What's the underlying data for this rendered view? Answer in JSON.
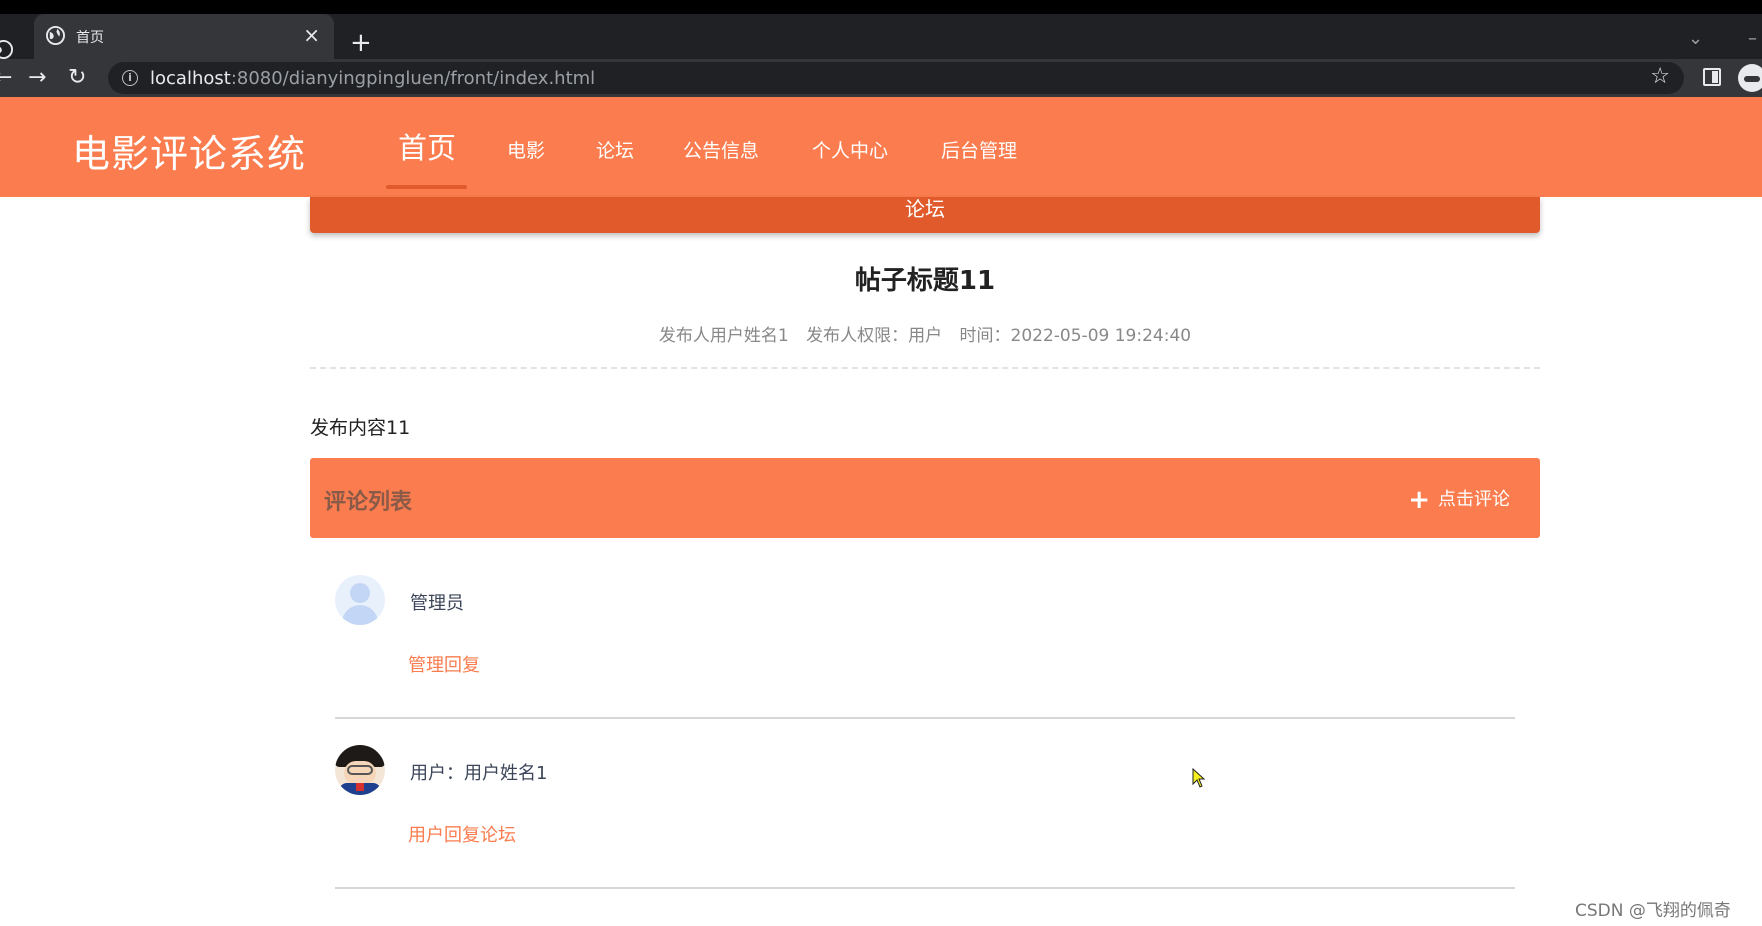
{
  "browser": {
    "tab_title": "首页",
    "url_host": "localhost",
    "url_rest": ":8080/dianyingpingluen/front/index.html",
    "icons": [
      "globe-icon",
      "close-icon",
      "plus-icon",
      "back-icon",
      "forward-icon",
      "reload-icon",
      "info-icon",
      "star-icon",
      "side-panel-icon",
      "profile-icon",
      "chevron-down-icon"
    ]
  },
  "site": {
    "brand": "电影评论系统",
    "accent_color": "#fb7c4e",
    "nav": [
      {
        "label": "首页",
        "active": true
      },
      {
        "label": "电影"
      },
      {
        "label": "论坛"
      },
      {
        "label": "公告信息"
      },
      {
        "label": "个人中心"
      },
      {
        "label": "后台管理"
      }
    ]
  },
  "page": {
    "banner": "论坛",
    "post": {
      "title": "帖子标题11",
      "author": "发布人用户姓名1",
      "role": "发布人权限：用户",
      "time": "时间：2022-05-09 19:24:40",
      "content": "发布内容11"
    },
    "comments_header": {
      "title": "评论列表",
      "add_label": "点击评论"
    },
    "comments": [
      {
        "user": "管理员",
        "text": "管理回复",
        "avatar": "default-avatar"
      },
      {
        "user": "用户：用户姓名1",
        "text": "用户回复论坛",
        "avatar": "cartoon-avatar"
      }
    ]
  },
  "watermark": "CSDN @飞翔的佩奇"
}
